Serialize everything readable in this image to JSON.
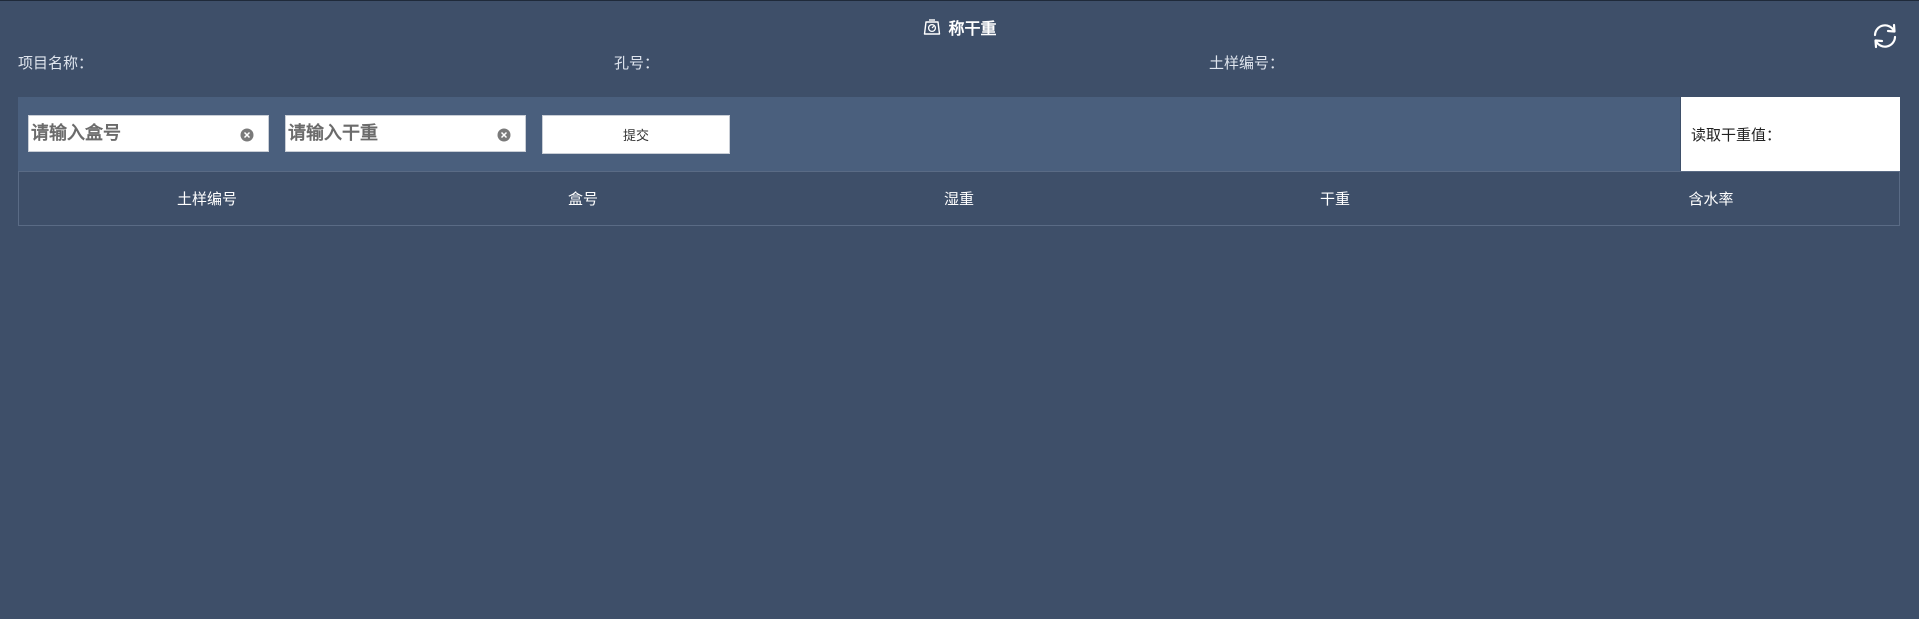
{
  "header": {
    "title": "称干重",
    "title_icon": "scale-icon",
    "refresh_icon": "refresh-icon"
  },
  "info": {
    "project_name_label": "项目名称：",
    "hole_no_label": "孔号：",
    "sample_no_label": "土样编号："
  },
  "toolbar": {
    "box_input": {
      "value": "",
      "placeholder": "请输入盒号"
    },
    "dry_weight_input": {
      "value": "",
      "placeholder": "请输入干重"
    },
    "submit_label": "提交",
    "read_dry_weight_label": "读取干重值："
  },
  "table": {
    "columns": [
      "土样编号",
      "盒号",
      "湿重",
      "干重",
      "含水率"
    ],
    "rows": []
  },
  "colors": {
    "background": "#3e4f69",
    "toolbar": "#4a5f7d",
    "panel": "#ffffff"
  }
}
